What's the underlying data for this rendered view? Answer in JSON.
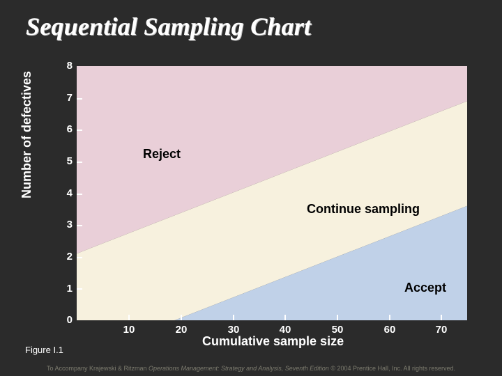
{
  "title": "Sequential Sampling Chart",
  "yAxisLabel": "Number of defectives",
  "xAxisLabel": "Cumulative sample size",
  "figureLabel": "Figure I.1",
  "footerPrefix": "To Accompany Krajewski & Ritzman ",
  "footerItalic": "Operations Management: Strategy and Analysis, Seventh Edition",
  "footerSuffix": " © 2004 Prentice Hall, Inc. All rights reserved.",
  "regions": {
    "reject": "Reject",
    "continue": "Continue sampling",
    "accept": "Accept"
  },
  "yticks": [
    "8",
    "7",
    "6",
    "5",
    "4",
    "3",
    "2",
    "1",
    "0"
  ],
  "xticks": [
    "10",
    "20",
    "30",
    "40",
    "50",
    "60",
    "70"
  ],
  "chart_data": {
    "type": "area",
    "title": "Sequential Sampling Chart",
    "xlabel": "Cumulative sample size",
    "ylabel": "Number of defectives",
    "xlim": [
      0,
      75
    ],
    "ylim": [
      0,
      8
    ],
    "xticks": [
      10,
      20,
      30,
      40,
      50,
      60,
      70
    ],
    "yticks": [
      0,
      1,
      2,
      3,
      4,
      5,
      6,
      7,
      8
    ],
    "series": [
      {
        "name": "Reject boundary (upper line)",
        "x": [
          0,
          75
        ],
        "y": [
          2.1,
          6.9
        ]
      },
      {
        "name": "Accept boundary (lower line)",
        "x": [
          0,
          75
        ],
        "y": [
          -1.2,
          3.6
        ]
      }
    ],
    "regions": [
      {
        "name": "Reject",
        "description": "Area above upper boundary line",
        "color": "#e9cfd8"
      },
      {
        "name": "Continue sampling",
        "description": "Area between the two boundary lines",
        "color": "#f7f1de"
      },
      {
        "name": "Accept",
        "description": "Area below lower boundary line",
        "color": "#c0d1e8"
      }
    ]
  }
}
